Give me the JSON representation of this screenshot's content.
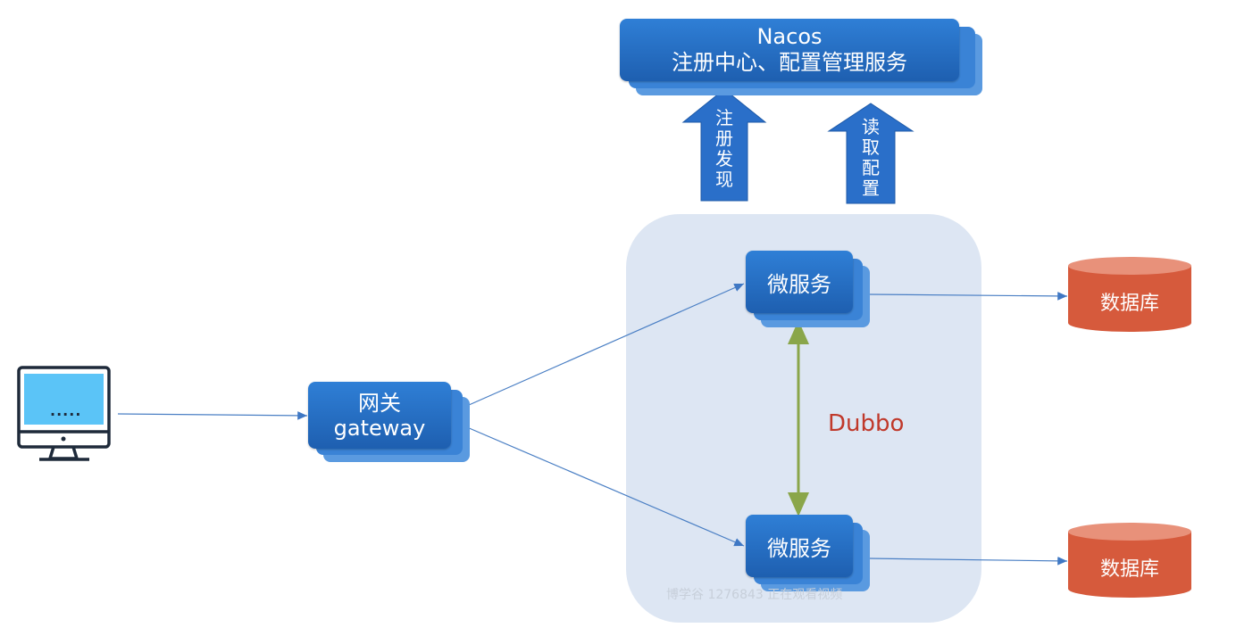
{
  "nacos": {
    "title": "Nacos",
    "subtitle": "注册中心、配置管理服务"
  },
  "arrows": {
    "register": "注\n册\n发\n现",
    "config": "读\n取\n配\n置"
  },
  "gateway": {
    "line1": "网关",
    "line2": "gateway"
  },
  "services": {
    "top": "微服务",
    "bottom": "微服务"
  },
  "databases": {
    "top": "数据库",
    "bottom": "数据库"
  },
  "rpc_label": "Dubbo",
  "client": {
    "screen_text": "....."
  },
  "watermark": "博学谷 1276843 正在观看视频",
  "colors": {
    "box_blue": "#2f7fd6",
    "cluster_bg": "#dde6f3",
    "db_red": "#d65a3c",
    "dubbo_line": "#8aa64a",
    "connector": "#4a7fc4"
  }
}
